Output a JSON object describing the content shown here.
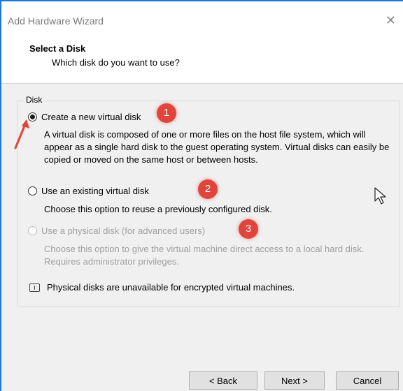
{
  "window": {
    "title": "Add Hardware Wizard",
    "close_glyph": "✕"
  },
  "header": {
    "title": "Select a Disk",
    "subtitle": "Which disk do you want to use?"
  },
  "disk_group": {
    "label": "Disk",
    "options": [
      {
        "label": "Create a new virtual disk",
        "checked": true,
        "enabled": true,
        "description": "A virtual disk is composed of one or more files on the host file system, which will appear as a single hard disk to the guest operating system. Virtual disks can easily be copied or moved on the same host or between hosts."
      },
      {
        "label": "Use an existing virtual disk",
        "checked": false,
        "enabled": true,
        "description": "Choose this option to reuse a previously configured disk."
      },
      {
        "label": "Use a physical disk (for advanced users)",
        "checked": false,
        "enabled": false,
        "description": "Choose this option to give the virtual machine direct access to a local hard disk. Requires administrator privileges."
      }
    ],
    "note": "Physical disks are unavailable for encrypted virtual machines."
  },
  "annotations": {
    "badges": [
      "1",
      "2",
      "3"
    ],
    "badge_color": "#e0443a"
  },
  "buttons": {
    "back": "< Back",
    "next": "Next >",
    "cancel": "Cancel"
  },
  "colors": {
    "title_border": "#1b78d4",
    "dialog_bg": "#f0f0f0"
  }
}
